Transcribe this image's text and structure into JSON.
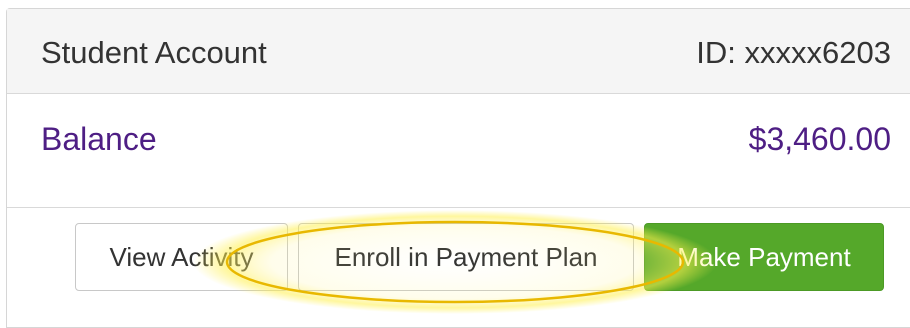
{
  "header": {
    "title": "Student Account",
    "account_id": "ID: xxxxx6203"
  },
  "balance": {
    "label": "Balance",
    "amount": "$3,460.00"
  },
  "actions": {
    "view_activity_label": "View Activity",
    "enroll_plan_label": "Enroll in Payment Plan",
    "make_payment_label": "Make Payment"
  },
  "colors": {
    "accent_purple": "#4e1e84",
    "primary_green": "#55a82a",
    "highlight_yellow": "#f2d400"
  }
}
